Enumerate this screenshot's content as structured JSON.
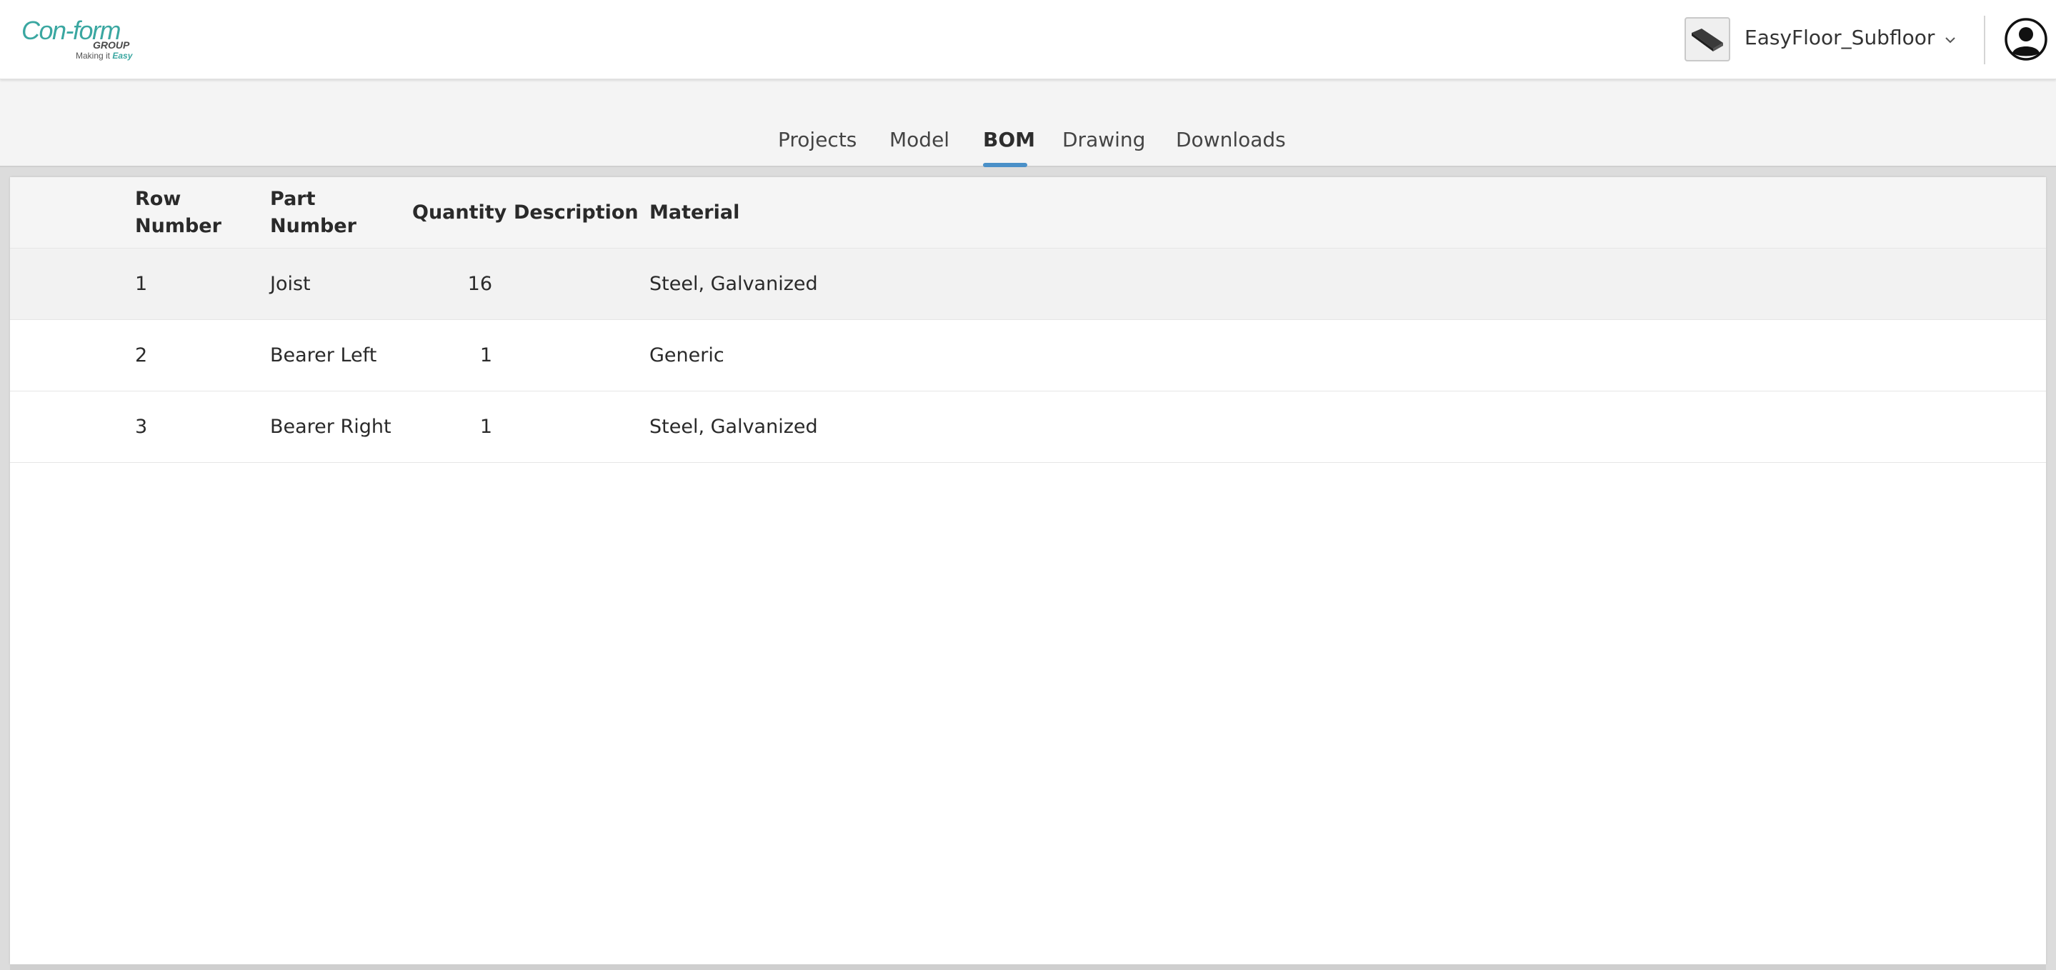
{
  "header": {
    "logo": {
      "main": "Con-form",
      "group": "GROUP",
      "tagline_prefix": "Making it ",
      "tagline_emphasis": "Easy"
    },
    "model": {
      "name": "EasyFloor_Subfloor",
      "thumbnail_icon": "floor-panel-thumbnail-icon",
      "dropdown_icon": "chevron-down-icon"
    },
    "user_icon": "user-avatar-icon"
  },
  "nav": {
    "tabs": [
      {
        "label": "Projects",
        "active": false
      },
      {
        "label": "Model",
        "active": false
      },
      {
        "label": "BOM",
        "active": true
      },
      {
        "label": "Drawing",
        "active": false
      },
      {
        "label": "Downloads",
        "active": false
      }
    ],
    "accent_color": "#4a90c8"
  },
  "bom": {
    "columns": {
      "row_number": "Row Number",
      "part_number": "Part Number",
      "quantity": "Quantity",
      "description": "Description",
      "material": "Material"
    },
    "rows": [
      {
        "row_number": "1",
        "part_number": "Joist",
        "quantity": "16",
        "description": "",
        "material": "Steel, Galvanized"
      },
      {
        "row_number": "2",
        "part_number": "Bearer Left",
        "quantity": "1",
        "description": "",
        "material": "Generic"
      },
      {
        "row_number": "3",
        "part_number": "Bearer Right",
        "quantity": "1",
        "description": "",
        "material": "Steel, Galvanized"
      }
    ]
  },
  "colors": {
    "brand_teal": "#3aa7a1",
    "row_hover": "#f2f2f2"
  }
}
